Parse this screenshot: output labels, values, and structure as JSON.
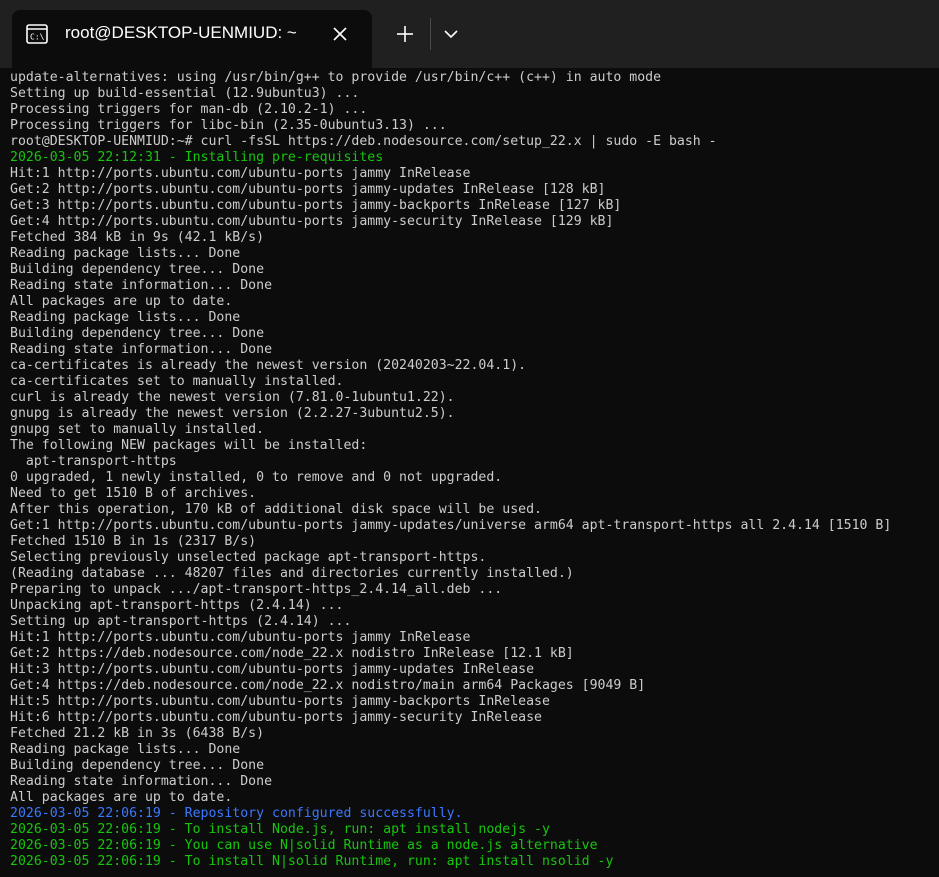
{
  "window": {
    "tab_title": "root@DESKTOP-UENMIUD: ~",
    "tab_icon": "terminal-icon",
    "close_icon": "close-icon",
    "new_tab_icon": "plus-icon",
    "dropdown_icon": "chevron-down-icon"
  },
  "colors": {
    "background": "#0c0c0c",
    "titlebar": "#202020",
    "text": "#cccccc",
    "green": "#16c60c",
    "blue": "#3b78ff"
  },
  "terminal": {
    "lines": [
      {
        "text": "update-alternatives: using /usr/bin/g++ to provide /usr/bin/c++ (c++) in auto mode",
        "color": "default"
      },
      {
        "text": "Setting up build-essential (12.9ubuntu3) ...",
        "color": "default"
      },
      {
        "text": "Processing triggers for man-db (2.10.2-1) ...",
        "color": "default"
      },
      {
        "text": "Processing triggers for libc-bin (2.35-0ubuntu3.13) ...",
        "color": "default"
      },
      {
        "text": "root@DESKTOP-UENMIUD:~# curl -fsSL https://deb.nodesource.com/setup_22.x | sudo -E bash -",
        "color": "default"
      },
      {
        "text": "2026-03-05 22:12:31 - Installing pre-requisites",
        "color": "green"
      },
      {
        "text": "Hit:1 http://ports.ubuntu.com/ubuntu-ports jammy InRelease",
        "color": "default"
      },
      {
        "text": "Get:2 http://ports.ubuntu.com/ubuntu-ports jammy-updates InRelease [128 kB]",
        "color": "default"
      },
      {
        "text": "Get:3 http://ports.ubuntu.com/ubuntu-ports jammy-backports InRelease [127 kB]",
        "color": "default"
      },
      {
        "text": "Get:4 http://ports.ubuntu.com/ubuntu-ports jammy-security InRelease [129 kB]",
        "color": "default"
      },
      {
        "text": "Fetched 384 kB in 9s (42.1 kB/s)",
        "color": "default"
      },
      {
        "text": "Reading package lists... Done",
        "color": "default"
      },
      {
        "text": "Building dependency tree... Done",
        "color": "default"
      },
      {
        "text": "Reading state information... Done",
        "color": "default"
      },
      {
        "text": "All packages are up to date.",
        "color": "default"
      },
      {
        "text": "Reading package lists... Done",
        "color": "default"
      },
      {
        "text": "Building dependency tree... Done",
        "color": "default"
      },
      {
        "text": "Reading state information... Done",
        "color": "default"
      },
      {
        "text": "ca-certificates is already the newest version (20240203~22.04.1).",
        "color": "default"
      },
      {
        "text": "ca-certificates set to manually installed.",
        "color": "default"
      },
      {
        "text": "curl is already the newest version (7.81.0-1ubuntu1.22).",
        "color": "default"
      },
      {
        "text": "gnupg is already the newest version (2.2.27-3ubuntu2.5).",
        "color": "default"
      },
      {
        "text": "gnupg set to manually installed.",
        "color": "default"
      },
      {
        "text": "The following NEW packages will be installed:",
        "color": "default"
      },
      {
        "text": "  apt-transport-https",
        "color": "default"
      },
      {
        "text": "0 upgraded, 1 newly installed, 0 to remove and 0 not upgraded.",
        "color": "default"
      },
      {
        "text": "Need to get 1510 B of archives.",
        "color": "default"
      },
      {
        "text": "After this operation, 170 kB of additional disk space will be used.",
        "color": "default"
      },
      {
        "text": "Get:1 http://ports.ubuntu.com/ubuntu-ports jammy-updates/universe arm64 apt-transport-https all 2.4.14 [1510 B]",
        "color": "default"
      },
      {
        "text": "Fetched 1510 B in 1s (2317 B/s)",
        "color": "default"
      },
      {
        "text": "Selecting previously unselected package apt-transport-https.",
        "color": "default"
      },
      {
        "text": "(Reading database ... 48207 files and directories currently installed.)",
        "color": "default"
      },
      {
        "text": "Preparing to unpack .../apt-transport-https_2.4.14_all.deb ...",
        "color": "default"
      },
      {
        "text": "Unpacking apt-transport-https (2.4.14) ...",
        "color": "default"
      },
      {
        "text": "Setting up apt-transport-https (2.4.14) ...",
        "color": "default"
      },
      {
        "text": "Hit:1 http://ports.ubuntu.com/ubuntu-ports jammy InRelease",
        "color": "default"
      },
      {
        "text": "Get:2 https://deb.nodesource.com/node_22.x nodistro InRelease [12.1 kB]",
        "color": "default"
      },
      {
        "text": "Hit:3 http://ports.ubuntu.com/ubuntu-ports jammy-updates InRelease",
        "color": "default"
      },
      {
        "text": "Get:4 https://deb.nodesource.com/node_22.x nodistro/main arm64 Packages [9049 B]",
        "color": "default"
      },
      {
        "text": "Hit:5 http://ports.ubuntu.com/ubuntu-ports jammy-backports InRelease",
        "color": "default"
      },
      {
        "text": "Hit:6 http://ports.ubuntu.com/ubuntu-ports jammy-security InRelease",
        "color": "default"
      },
      {
        "text": "Fetched 21.2 kB in 3s (6438 B/s)",
        "color": "default"
      },
      {
        "text": "Reading package lists... Done",
        "color": "default"
      },
      {
        "text": "Building dependency tree... Done",
        "color": "default"
      },
      {
        "text": "Reading state information... Done",
        "color": "default"
      },
      {
        "text": "All packages are up to date.",
        "color": "default"
      },
      {
        "text": "2026-03-05 22:06:19 - Repository configured successfully.",
        "color": "blue"
      },
      {
        "text": "2026-03-05 22:06:19 - To install Node.js, run: apt install nodejs -y",
        "color": "green"
      },
      {
        "text": "2026-03-05 22:06:19 - You can use N|solid Runtime as a node.js alternative",
        "color": "green"
      },
      {
        "text": "2026-03-05 22:06:19 - To install N|solid Runtime, run: apt install nsolid -y",
        "color": "green"
      }
    ]
  }
}
